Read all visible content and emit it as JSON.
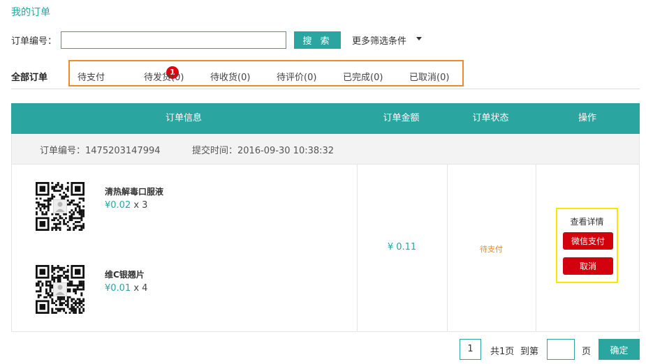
{
  "page_title": "我的订单",
  "search": {
    "label": "订单编号：",
    "value": "",
    "button_label": "搜 索",
    "more_filters_label": "更多筛选条件"
  },
  "tabs": {
    "all_label": "全部订单",
    "items": [
      {
        "label": "待支付",
        "badge": "1"
      },
      {
        "label": "待发货(0)"
      },
      {
        "label": "待收货(0)"
      },
      {
        "label": "待评价(0)"
      },
      {
        "label": "已完成(0)"
      },
      {
        "label": "已取消(0)"
      }
    ]
  },
  "table": {
    "headers": [
      "订单信息",
      "订单金额",
      "订单状态",
      "操作"
    ]
  },
  "order": {
    "number_text": "订单编号：1475203147994",
    "time_text": "提交时间：2016-09-30 10:38:32",
    "products": [
      {
        "name": "清热解毒口服液",
        "price": "¥0.02",
        "qty": "x 3"
      },
      {
        "name": "维C银翘片",
        "price": "¥0.01",
        "qty": "x 4"
      }
    ],
    "amount": "¥ 0.11",
    "status": "待支付",
    "actions": {
      "detail_label": "查看详情",
      "pay_label": "微信支付",
      "cancel_label": "取消"
    }
  },
  "pagination": {
    "current_page": "1",
    "total_text": "共1页",
    "goto_prefix": "到第",
    "goto_value": "",
    "goto_suffix": "页",
    "confirm_label": "确定"
  },
  "colors": {
    "accent": "#2aa5a0",
    "tab_highlight_border": "#f0892a",
    "ops_highlight_border": "#ffe600",
    "badge": "#e0000f",
    "danger_button": "#d3000d",
    "status_text": "#f0892a"
  }
}
